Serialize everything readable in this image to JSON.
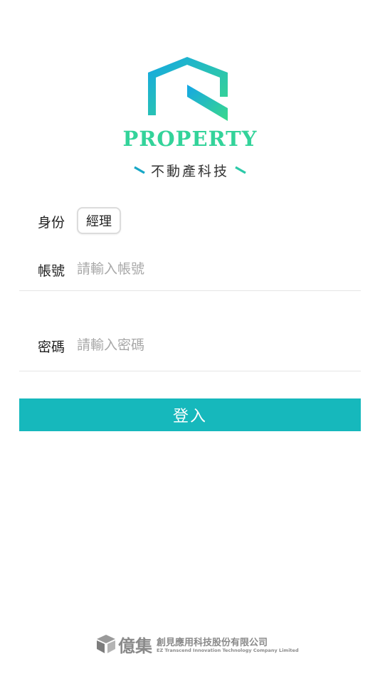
{
  "brand": {
    "name": "PROPERTY",
    "subtitle": "不動產科技",
    "colors": {
      "gradient_start": "#14a6e6",
      "gradient_end": "#3ad98a",
      "slash_left": "#17a7c6",
      "slash_right": "#2bc9a8"
    }
  },
  "form": {
    "role": {
      "label": "身份",
      "selected": "經理"
    },
    "account": {
      "label": "帳號",
      "placeholder": "請輸入帳號",
      "value": ""
    },
    "password": {
      "label": "密碼",
      "placeholder": "請輸入密碼",
      "value": ""
    },
    "submit_label": "登入"
  },
  "footer": {
    "company_short": "億集",
    "company_full_zh": "創見應用科技股份有限公司",
    "company_full_en": "EZ Transcend Innovation Technology Company Limited"
  },
  "theme": {
    "accent": "#16b8bc",
    "placeholder": "#a8a8a8",
    "divider": "#e6e6e6"
  }
}
